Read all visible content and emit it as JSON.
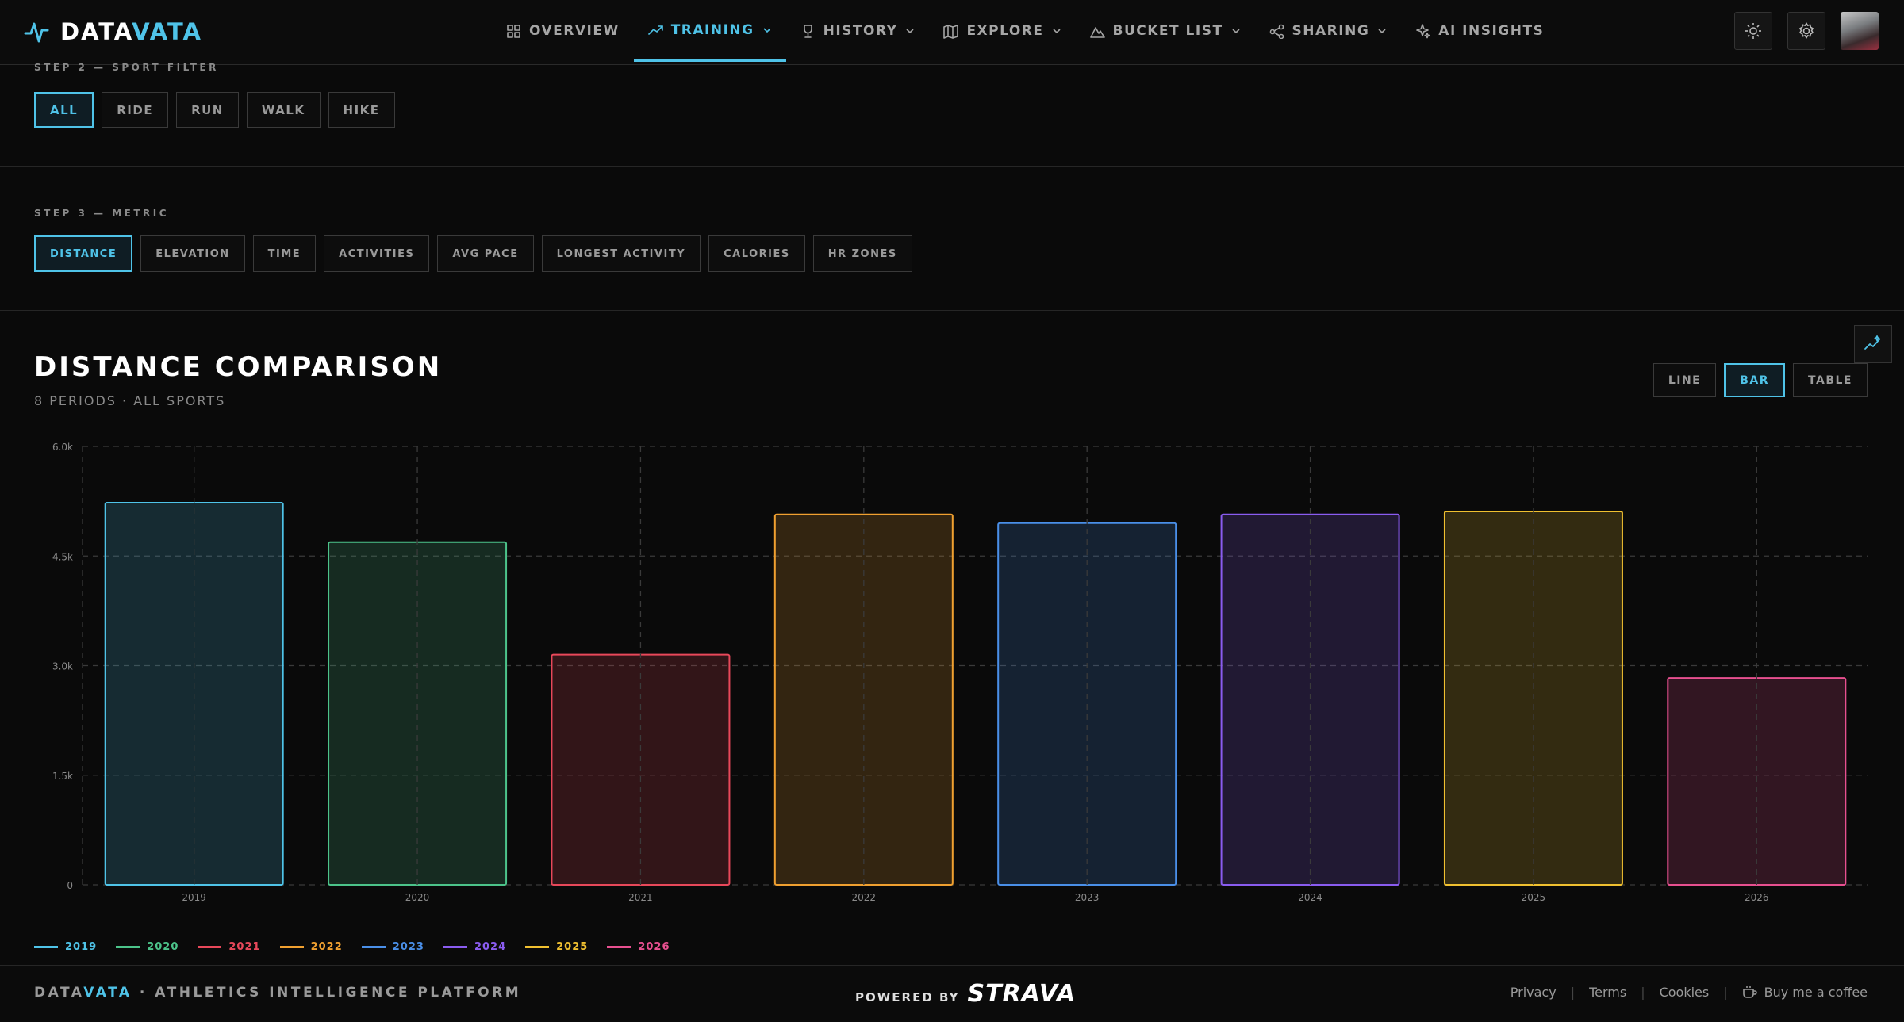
{
  "brand": {
    "name_main": "DATA",
    "name_accent": "VATA"
  },
  "nav": {
    "items": [
      {
        "label": "OVERVIEW",
        "icon": "grid-icon",
        "dropdown": false,
        "active": false
      },
      {
        "label": "TRAINING",
        "icon": "trend-icon",
        "dropdown": true,
        "active": true
      },
      {
        "label": "HISTORY",
        "icon": "trophy-icon",
        "dropdown": true,
        "active": false
      },
      {
        "label": "EXPLORE",
        "icon": "map-icon",
        "dropdown": true,
        "active": false
      },
      {
        "label": "BUCKET LIST",
        "icon": "mountain-icon",
        "dropdown": true,
        "active": false
      },
      {
        "label": "SHARING",
        "icon": "share-icon",
        "dropdown": true,
        "active": false
      },
      {
        "label": "AI INSIGHTS",
        "icon": "sparkle-icon",
        "dropdown": false,
        "active": false
      }
    ]
  },
  "sport_filter": {
    "label": "STEP 2 — SPORT FILTER",
    "options": [
      "ALL",
      "RIDE",
      "RUN",
      "WALK",
      "HIKE"
    ],
    "selected": "ALL"
  },
  "metric": {
    "label": "STEP 3 — METRIC",
    "options": [
      "DISTANCE",
      "ELEVATION",
      "TIME",
      "ACTIVITIES",
      "AVG PACE",
      "LONGEST ACTIVITY",
      "CALORIES",
      "HR ZONES"
    ],
    "selected": "DISTANCE"
  },
  "chart_header": {
    "title": "DISTANCE COMPARISON",
    "subtitle": "8 PERIODS · ALL SPORTS",
    "views": [
      "LINE",
      "BAR",
      "TABLE"
    ],
    "selected_view": "BAR"
  },
  "chart_data": {
    "type": "bar",
    "categories": [
      "2019",
      "2020",
      "2021",
      "2022",
      "2023",
      "2024",
      "2025",
      "2026"
    ],
    "values": [
      5230,
      4690,
      3150,
      5070,
      4950,
      5070,
      5110,
      2830
    ],
    "colors": [
      "#4fc3e8",
      "#4cc38a",
      "#e8485a",
      "#f0a030",
      "#4a8fe8",
      "#8a5cf0",
      "#f0c030",
      "#e85090"
    ],
    "ylim": [
      0,
      6000
    ],
    "yticks": [
      "0",
      "1.5k",
      "3.0k",
      "4.5k",
      "6.0k"
    ],
    "ytick_values": [
      0,
      1500,
      3000,
      4500,
      6000
    ],
    "grid": true,
    "legend_position": "bottom-left",
    "xlabel": "",
    "ylabel": ""
  },
  "legend": [
    {
      "label": "2019",
      "color": "#4fc3e8"
    },
    {
      "label": "2020",
      "color": "#4cc38a"
    },
    {
      "label": "2021",
      "color": "#e8485a"
    },
    {
      "label": "2022",
      "color": "#f0a030"
    },
    {
      "label": "2023",
      "color": "#4a8fe8"
    },
    {
      "label": "2024",
      "color": "#8a5cf0"
    },
    {
      "label": "2025",
      "color": "#f0c030"
    },
    {
      "label": "2026",
      "color": "#e85090"
    }
  ],
  "footer": {
    "brand_main": "DATA",
    "brand_accent": "VATA",
    "tagline": " · ATHLETICS INTELLIGENCE PLATFORM",
    "powered_label": "POWERED BY",
    "powered_brand": "STRAVA",
    "links": [
      "Privacy",
      "Terms",
      "Cookies"
    ],
    "coffee": "Buy me a coffee"
  }
}
